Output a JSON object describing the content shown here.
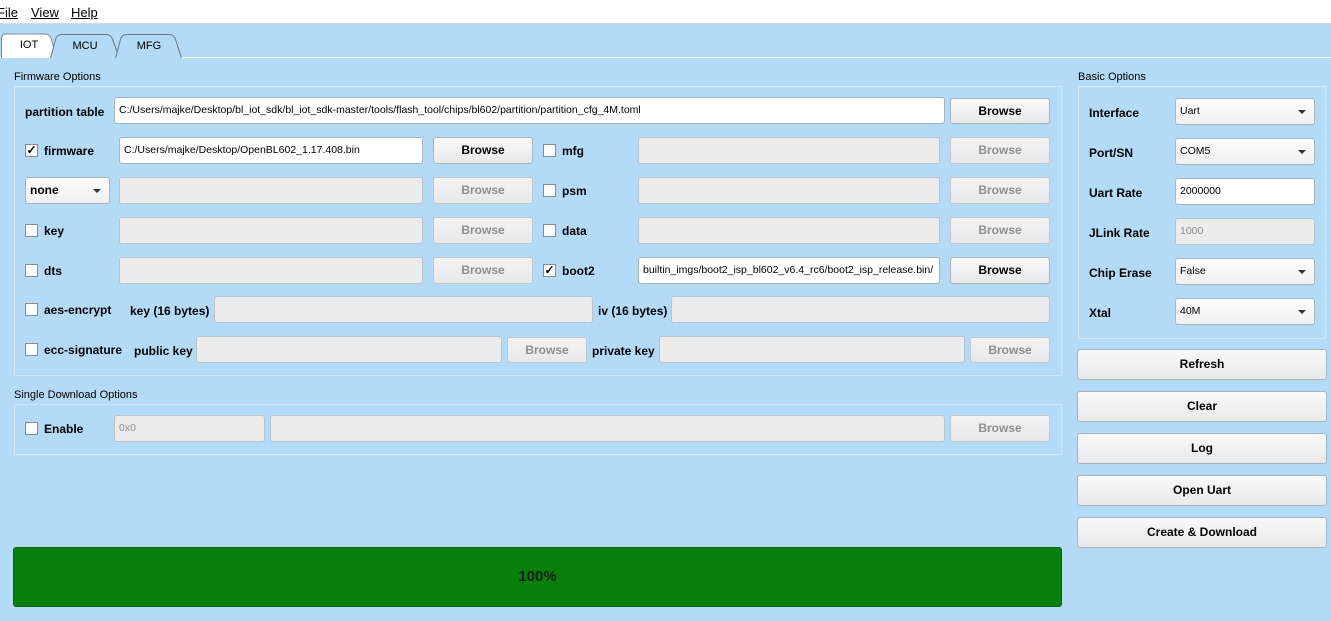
{
  "menu": {
    "file": "File",
    "view": "View",
    "help": "Help"
  },
  "tabs": [
    "IOT",
    "MCU",
    "MFG"
  ],
  "firmware_options": {
    "title": "Firmware Options",
    "partition_table": {
      "label": "partition table",
      "value": "C:/Users/majke/Desktop/bl_iot_sdk/bl_iot_sdk-master/tools/flash_tool/chips/bl602/partition/partition_cfg_4M.toml",
      "browse": "Browse"
    },
    "firmware": {
      "label": "firmware",
      "checked": "✓",
      "value": "C:/Users/majke/Desktop/OpenBL602_1.17.408.bin",
      "browse": "Browse"
    },
    "none_select": {
      "value": "none",
      "browse": "Browse"
    },
    "key": {
      "label": "key",
      "browse": "Browse"
    },
    "dts": {
      "label": "dts",
      "browse": "Browse"
    },
    "mfg": {
      "label": "mfg",
      "browse": "Browse"
    },
    "psm": {
      "label": "psm",
      "browse": "Browse"
    },
    "data": {
      "label": "data",
      "browse": "Browse"
    },
    "boot2": {
      "label": "boot2",
      "checked": "✓",
      "value": "/builtin_imgs/boot2_isp_bl602_v6.4_rc6/boot2_isp_release.bin",
      "browse": "Browse"
    },
    "aes_encrypt": {
      "label": "aes-encrypt",
      "key_label": "key (16 bytes)",
      "iv_label": "iv (16 bytes)"
    },
    "ecc_signature": {
      "label": "ecc-signature",
      "public_key_label": "public key",
      "private_key_label": "private key",
      "browse_public": "Browse",
      "browse_private": "Browse"
    }
  },
  "single_download": {
    "title": "Single Download Options",
    "enable_label": "Enable",
    "address_placeholder": "0x0",
    "browse": "Browse"
  },
  "basic_options": {
    "title": "Basic Options",
    "interface": {
      "label": "Interface",
      "value": "Uart"
    },
    "port": {
      "label": "Port/SN",
      "value": "COM5"
    },
    "uart_rate": {
      "label": "Uart Rate",
      "value": "2000000"
    },
    "jlink_rate": {
      "label": "JLink Rate",
      "value": "1000"
    },
    "chip_erase": {
      "label": "Chip Erase",
      "value": "False"
    },
    "xtal": {
      "label": "Xtal",
      "value": "40M"
    }
  },
  "actions": {
    "refresh": "Refresh",
    "clear": "Clear",
    "log": "Log",
    "open_uart": "Open Uart",
    "create_download": "Create & Download"
  },
  "progress": {
    "percent": 100,
    "label": "100%"
  }
}
